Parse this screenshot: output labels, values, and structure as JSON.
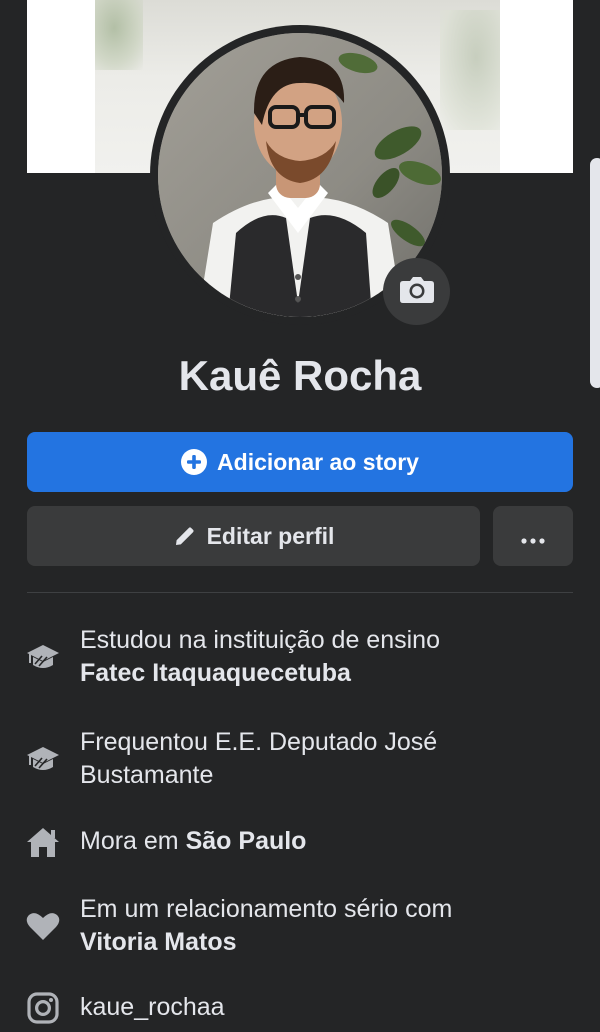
{
  "profile": {
    "name": "Kauê Rocha"
  },
  "actions": {
    "add_story_label": "Adicionar ao story",
    "edit_profile_label": "Editar perfil",
    "more_label": "•••"
  },
  "details": {
    "education1": {
      "prefix": "Estudou na instituição de ensino",
      "value": "Fatec Itaquaquecetuba"
    },
    "education2": {
      "text": "Frequentou E.E. Deputado José Bustamante"
    },
    "residence": {
      "prefix": "Mora em",
      "value": "São Paulo"
    },
    "relationship": {
      "prefix": "Em um relacionamento sério com",
      "value": "Vitoria Matos"
    },
    "instagram": {
      "handle": "kaue_rochaa"
    }
  },
  "icons": {
    "camera": "camera-icon",
    "add": "plus-circle-icon",
    "edit": "pencil-icon",
    "more": "more-dots-icon",
    "education": "graduation-cap-icon",
    "home": "home-icon",
    "relationship": "heart-icon",
    "instagram": "instagram-icon"
  },
  "colors": {
    "background": "#242526",
    "primary": "#2374e1",
    "secondary_button": "#3a3b3c",
    "text": "#e4e6eb",
    "icon": "#b0b3b8"
  }
}
